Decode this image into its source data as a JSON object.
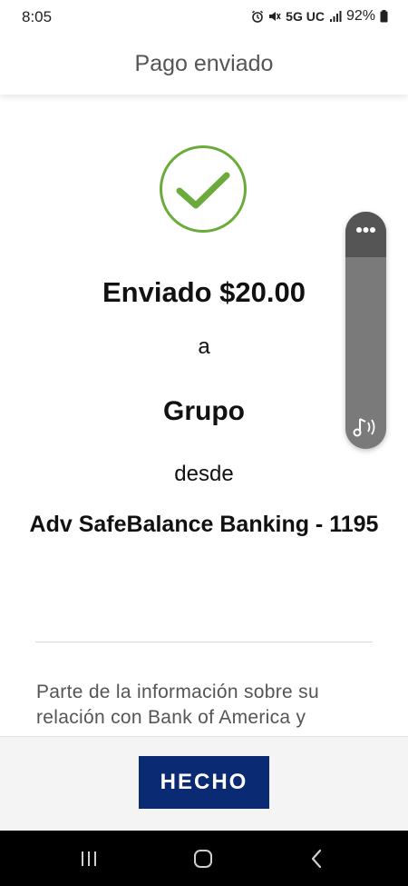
{
  "status_bar": {
    "time": "8:05",
    "network": "5G UC",
    "battery": "92%"
  },
  "header": {
    "title": "Pago enviado"
  },
  "confirmation": {
    "amount_text": "Enviado $20.00",
    "to_text": "a",
    "recipient": "Grupo",
    "from_text": "desde",
    "account": "Adv SafeBalance Banking - 1195"
  },
  "info": {
    "text": "Parte de la información sobre su relación con Bank of America y"
  },
  "actions": {
    "done_label": "HECHO"
  },
  "colors": {
    "success": "#6aab3c",
    "primary_button": "#0a2a74"
  },
  "icons": {
    "check": "check-icon",
    "more": "more-dots-icon",
    "music": "music-note-icon",
    "recents": "recents-icon",
    "home": "home-icon",
    "back": "back-icon"
  }
}
